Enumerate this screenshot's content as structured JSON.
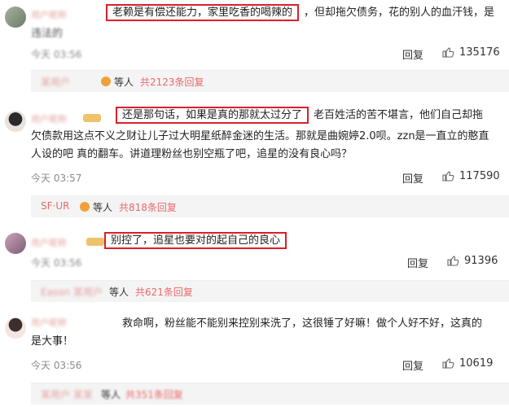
{
  "comments": [
    {
      "username": "用户昵称",
      "highlight": "老赖是有偿还能力，家里吃香的喝辣的",
      "text_rest": "，但却拖欠债务，花的别人的血汗钱，是",
      "text_line2": "违法的",
      "time": "今天 03:56",
      "reply_label": "回复",
      "likes": "135176",
      "sub": {
        "who": "某用户",
        "etc": "等人",
        "count": "共2123条回复"
      }
    },
    {
      "username": "用户昵称",
      "highlight": "还是那句话，如果是真的那就太过分了",
      "text_rest": "老百姓活的苦不堪言，他们自己却拖",
      "text_line2": "欠债款用这点不义之财让儿子过大明星纸醉金迷的生活。那就是曲婉婷2.0呗。zzn是一直立的憨直",
      "text_line3": "人设的吧 真的翻车。讲道理粉丝也别空瓶了吧，追星的没有良心吗？",
      "time": "今天 03:57",
      "reply_label": "回复",
      "likes": "117590",
      "sub": {
        "who": "SF·UR",
        "etc": "等人",
        "count": "共818条回复"
      }
    },
    {
      "username": "用户昵称",
      "highlight": "别控了，追星也要对的起自己的良心",
      "time": "今天 03:56",
      "reply_label": "回复",
      "likes": "91396",
      "sub": {
        "who": "Eason 某用户",
        "etc": "等人",
        "count": "共621条回复"
      }
    },
    {
      "username": "用户昵称",
      "text_line1": "救命啊，粉丝能不能别来控别来洗了，这很锤了好嘛！做个人好不好，这真的",
      "text_line2": "是大事！",
      "time": "今天 03:56",
      "reply_label": "回复",
      "likes": "10619",
      "sub": {
        "who": "某用户 某某",
        "etc": "等人",
        "count": "共351条回复"
      }
    }
  ],
  "icons": {
    "like": "thumbs-up-icon",
    "vip": "vip-badge-icon"
  },
  "colors": {
    "highlight_border": "#d9202a",
    "accent": "#e86a6a"
  }
}
